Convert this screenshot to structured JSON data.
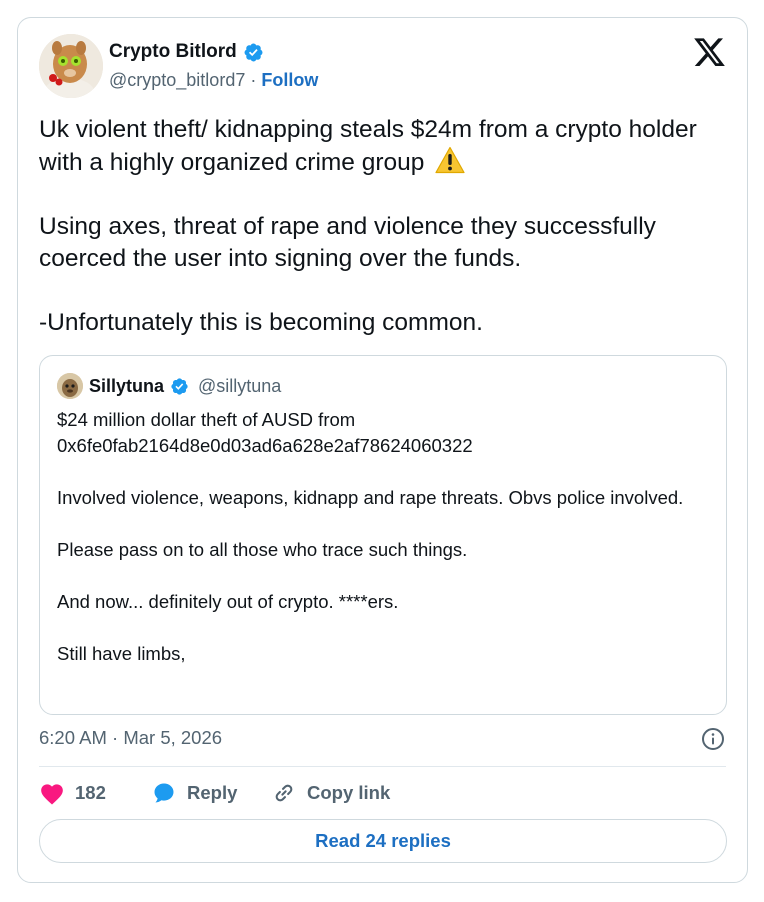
{
  "author": {
    "name": "Crypto Bitlord",
    "handle": "@crypto_bitlord7",
    "separator": "·",
    "follow_label": "Follow"
  },
  "tweet": {
    "paragraphs": [
      "Uk violent theft/ kidnapping steals $24m from a crypto holder with a highly organized crime group",
      "Using axes, threat of rape and violence they successfully coerced the user into signing over the funds.",
      "-Unfortunately this is becoming common."
    ],
    "emoji_icon": "warning-sign-emoji"
  },
  "quote": {
    "name": "Sillytuna",
    "handle": "@sillytuna",
    "lines": [
      "$24 million dollar theft of AUSD from",
      "0x6fe0fab2164d8e0d03ad6a628e2af78624060322",
      "Involved violence, weapons, kidnapp and rape threats. Obvs police involved.",
      "Please pass on to all those who trace such things.",
      "And now... definitely out of crypto. ****ers.",
      "Still have limbs,"
    ]
  },
  "meta": {
    "timestamp": "6:20 AM · Mar 5, 2026"
  },
  "actions": {
    "like_count": "182",
    "reply_label": "Reply",
    "copy_label": "Copy link"
  },
  "footer": {
    "read_replies_label": "Read 24 replies"
  },
  "colors": {
    "like": "#f91880",
    "reply": "#1d9bf0",
    "verified": "#1d9bf0",
    "link": "#1d6fc2",
    "muted": "#536471"
  }
}
